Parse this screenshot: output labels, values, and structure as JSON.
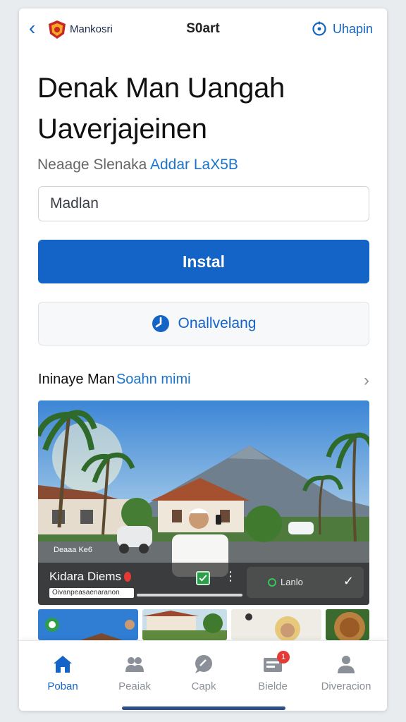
{
  "header": {
    "logo_text": "Mankosri",
    "logo_sub": "",
    "title": "S0art",
    "update_label": "Uhapin"
  },
  "main": {
    "heading": "Denak Man Uangah Uaverjajeinen",
    "subtitle_plain": "Neaage Slenaka",
    "subtitle_highlight": "Addar LaX5B",
    "input_value": "Madlan",
    "install_label": "Instal",
    "secondary_label": "Onallvelang"
  },
  "section": {
    "heading": "Ininaye Man",
    "link": "Soahn mimi"
  },
  "hero": {
    "tag": "Deaaa Ke6",
    "name": "Kidara Diems",
    "sub": "Oivanpeasaenaranon",
    "pill_label": "Lanlo"
  },
  "tabs": [
    {
      "label": "Poban",
      "icon": "home-icon",
      "active": true
    },
    {
      "label": "Peaiak",
      "icon": "people-icon",
      "active": false
    },
    {
      "label": "Capk",
      "icon": "chat-icon",
      "active": false
    },
    {
      "label": "Bielde",
      "icon": "inbox-icon",
      "active": false,
      "badge": "1"
    },
    {
      "label": "Diveracion",
      "icon": "person-icon",
      "active": false
    }
  ],
  "colors": {
    "accent": "#1463c6",
    "badge": "#e53935",
    "success": "#2e9d4b"
  }
}
